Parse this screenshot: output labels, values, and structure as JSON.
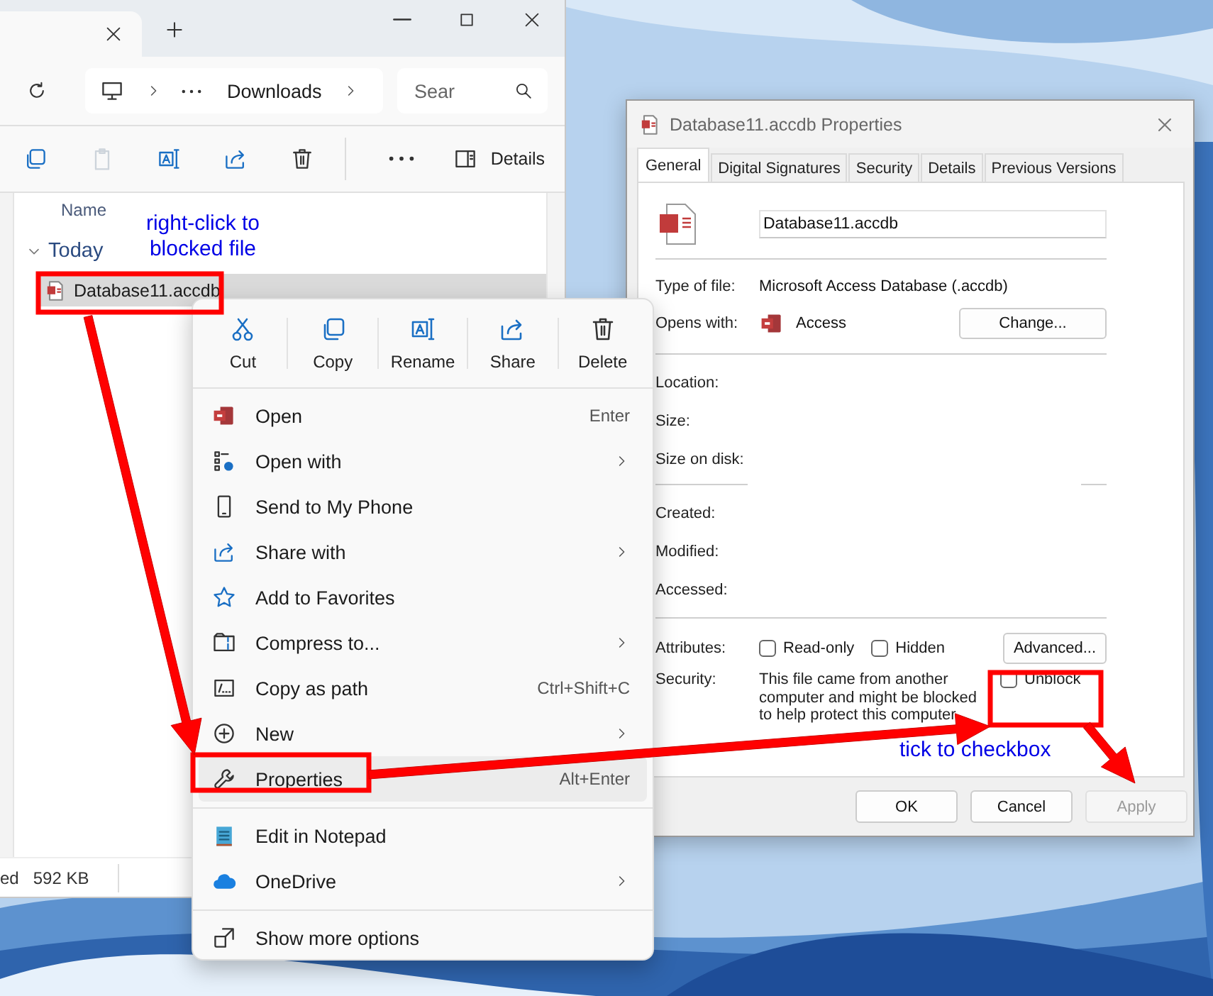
{
  "explorer": {
    "address": {
      "folder": "Downloads"
    },
    "search": {
      "placeholder": "Sear"
    },
    "toolbar": [
      {
        "disabled": false
      },
      {
        "disabled": true
      },
      {
        "disabled": false
      },
      {
        "disabled": false
      },
      {
        "disabled": false
      }
    ],
    "details_button": "Details",
    "column": "Name",
    "group": {
      "label": "Today",
      "expanded": true
    },
    "files": [
      {
        "name": "Database11.accdb",
        "selected": true
      }
    ],
    "status_bar": [
      "ed",
      "592 KB"
    ]
  },
  "context_menu": {
    "actions": [
      "Cut",
      "Copy",
      "Rename",
      "Share",
      "Delete"
    ],
    "items": [
      {
        "kind": "item",
        "label": "Open",
        "shortcut": "Enter",
        "submenu": false,
        "selected": false
      },
      {
        "kind": "item",
        "label": "Open with",
        "submenu": true,
        "selected": false
      },
      {
        "kind": "item",
        "label": "Send to My Phone",
        "submenu": false,
        "selected": false
      },
      {
        "kind": "item",
        "label": "Share with",
        "submenu": true,
        "selected": false
      },
      {
        "kind": "item",
        "label": "Add to Favorites",
        "submenu": false,
        "selected": false
      },
      {
        "kind": "item",
        "label": "Compress to...",
        "submenu": true,
        "selected": false
      },
      {
        "kind": "item",
        "label": "Copy as path",
        "shortcut": "Ctrl+Shift+C",
        "submenu": false,
        "selected": false
      },
      {
        "kind": "item",
        "label": "New",
        "submenu": true,
        "selected": false
      },
      {
        "kind": "item",
        "label": "Properties",
        "shortcut": "Alt+Enter",
        "submenu": false,
        "selected": true
      },
      {
        "kind": "divider"
      },
      {
        "kind": "item",
        "label": "Edit in Notepad",
        "submenu": false,
        "selected": false
      },
      {
        "kind": "item",
        "label": "OneDrive",
        "submenu": true,
        "selected": false
      },
      {
        "kind": "divider"
      },
      {
        "kind": "item",
        "label": "Show more options",
        "submenu": false,
        "selected": false
      }
    ]
  },
  "properties_dialog": {
    "title": "Database11.accdb Properties",
    "tabs": [
      {
        "label": "General",
        "selected": true
      },
      {
        "label": "Digital Signatures",
        "selected": false
      },
      {
        "label": "Security",
        "selected": false
      },
      {
        "label": "Details",
        "selected": false
      },
      {
        "label": "Previous Versions",
        "selected": false
      }
    ],
    "file_name": "Database11.accdb",
    "type_label": "Type of file:",
    "type_value": "Microsoft Access Database (.accdb)",
    "opens_label": "Opens with:",
    "opens_app": "Access",
    "change_button": "Change...",
    "location_fields": [
      "Location:",
      "Size:",
      "Size on disk:"
    ],
    "date_fields": [
      "Created:",
      "Modified:",
      "Accessed:"
    ],
    "attributes_label": "Attributes:",
    "attributes": [
      {
        "label": "Read-only",
        "checked": false
      },
      {
        "label": "Hidden",
        "checked": false
      }
    ],
    "advanced_button": "Advanced...",
    "security_label": "Security:",
    "security_text": "This file came from another computer and might be blocked to help protect this computer.",
    "unblock": {
      "label": "Unblock",
      "checked": false
    },
    "buttons": [
      {
        "label": "OK",
        "disabled": false
      },
      {
        "label": "Cancel",
        "disabled": false
      },
      {
        "label": "Apply",
        "disabled": true
      }
    ]
  },
  "annotations": [
    "right-click to blocked file",
    "tick to checkbox"
  ]
}
